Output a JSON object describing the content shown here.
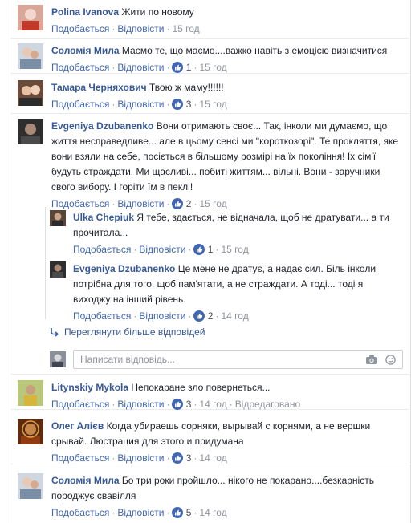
{
  "actions": {
    "like": "Подобається",
    "reply": "Відповісти",
    "edited": "Відредаговано",
    "sep": "·"
  },
  "comments": [
    {
      "author": "Polina Ivanova",
      "text": "Жити по новому",
      "reactions": "",
      "time": "15 год"
    },
    {
      "author": "Соломія Мила",
      "text": "Маємо те, що маємо....важко навіть з емоцією визначитися",
      "reactions": "1",
      "time": "15 год"
    },
    {
      "author": "Тамара Черняхович",
      "text": "Твою ж маму!!!!!!",
      "reactions": "3",
      "time": "15 год"
    },
    {
      "author": "Evgeniya Dzubanenko",
      "text": "Вони отримають своє... Так, інколи ми думаємо, що життя несправедливе... але в цьому сенсі ми \"короткозорі\". Те прокляття, яке вони взяли на себе, посіється в більшому розмірі на їх покоління! Їх сім'ї будуть страждати. Ми щасливі... побиті життям... вільні. Вони - заручники свого вибору. І горіти їм в пеклі!",
      "reactions": "2",
      "time": "15 год"
    },
    {
      "author": "Ulka Chepiuk",
      "text": "Я тебе, здається, не відначала, щоб не дратувати... а ти прочитала...",
      "reactions": "1",
      "time": "15 год"
    },
    {
      "author": "Evgeniya Dzubanenko",
      "text": "Це мене не дратує, а надає сил. Біль інколи потрібна для того, щоб пам'ятати, а не страждати. А тоді... тоді я виходжу на інший рівень.",
      "reactions": "2",
      "time": "14 год"
    },
    {
      "author": "Litynskiy Mykola",
      "text": "Непокаране зло повернеться...",
      "reactions": "3",
      "time": "14 год"
    },
    {
      "author": "Олег Алієв",
      "text": "Когда убираешь сорняки, вырывай с корнями, а не вершки срывай. Люстрация для этого и придумана",
      "reactions": "3",
      "time": "14 год"
    },
    {
      "author": "Соломія Мила",
      "text": "Бо три роки пройшло... нікого не покарано....безкарність породжує свавілля",
      "reactions": "5",
      "time": "14 год"
    }
  ],
  "more_replies": "Переглянути більше відповідей",
  "reply_placeholder": "Написати відповідь...",
  "colors": {
    "link": "#4267b2",
    "author": "#365899",
    "meta": "#90949c",
    "like_blue": "#4267b2",
    "love_red": "#f25268"
  }
}
